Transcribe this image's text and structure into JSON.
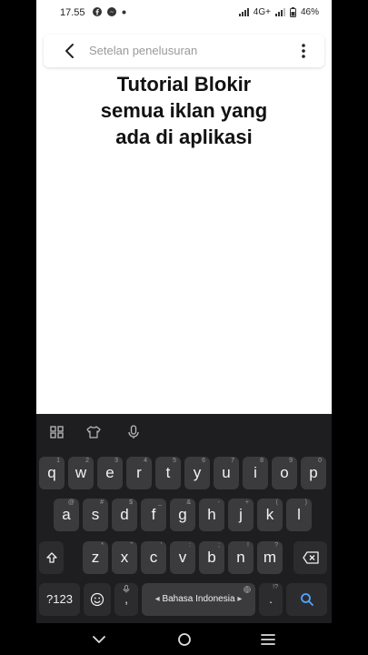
{
  "status": {
    "time": "17.55",
    "network": "4G+",
    "battery": "46%"
  },
  "search": {
    "placeholder": "Setelan penelusuran"
  },
  "overlay": {
    "line1": "Tutorial Blokir",
    "line2": "semua iklan yang",
    "line3": "ada di aplikasi"
  },
  "keyboard": {
    "row1": [
      {
        "label": "q",
        "hint": "1"
      },
      {
        "label": "w",
        "hint": "2"
      },
      {
        "label": "e",
        "hint": "3"
      },
      {
        "label": "r",
        "hint": "4"
      },
      {
        "label": "t",
        "hint": "5"
      },
      {
        "label": "y",
        "hint": "6"
      },
      {
        "label": "u",
        "hint": "7"
      },
      {
        "label": "i",
        "hint": "8"
      },
      {
        "label": "o",
        "hint": "9"
      },
      {
        "label": "p",
        "hint": "0"
      }
    ],
    "row2": [
      {
        "label": "a",
        "hint": "@"
      },
      {
        "label": "s",
        "hint": "#"
      },
      {
        "label": "d",
        "hint": "$"
      },
      {
        "label": "f",
        "hint": "_"
      },
      {
        "label": "g",
        "hint": "&"
      },
      {
        "label": "h",
        "hint": "-"
      },
      {
        "label": "j",
        "hint": "+"
      },
      {
        "label": "k",
        "hint": "("
      },
      {
        "label": "l",
        "hint": ")"
      }
    ],
    "row3": [
      {
        "label": "z",
        "hint": "*"
      },
      {
        "label": "x",
        "hint": "\""
      },
      {
        "label": "c",
        "hint": "'"
      },
      {
        "label": "v",
        "hint": ":"
      },
      {
        "label": "b",
        "hint": ";"
      },
      {
        "label": "n",
        "hint": "!"
      },
      {
        "label": "m",
        "hint": "?"
      }
    ],
    "symbols_label": "?123",
    "comma_label": ",",
    "space_label": "Bahasa Indonesia",
    "period_label": ".",
    "period_hint": "!?"
  }
}
